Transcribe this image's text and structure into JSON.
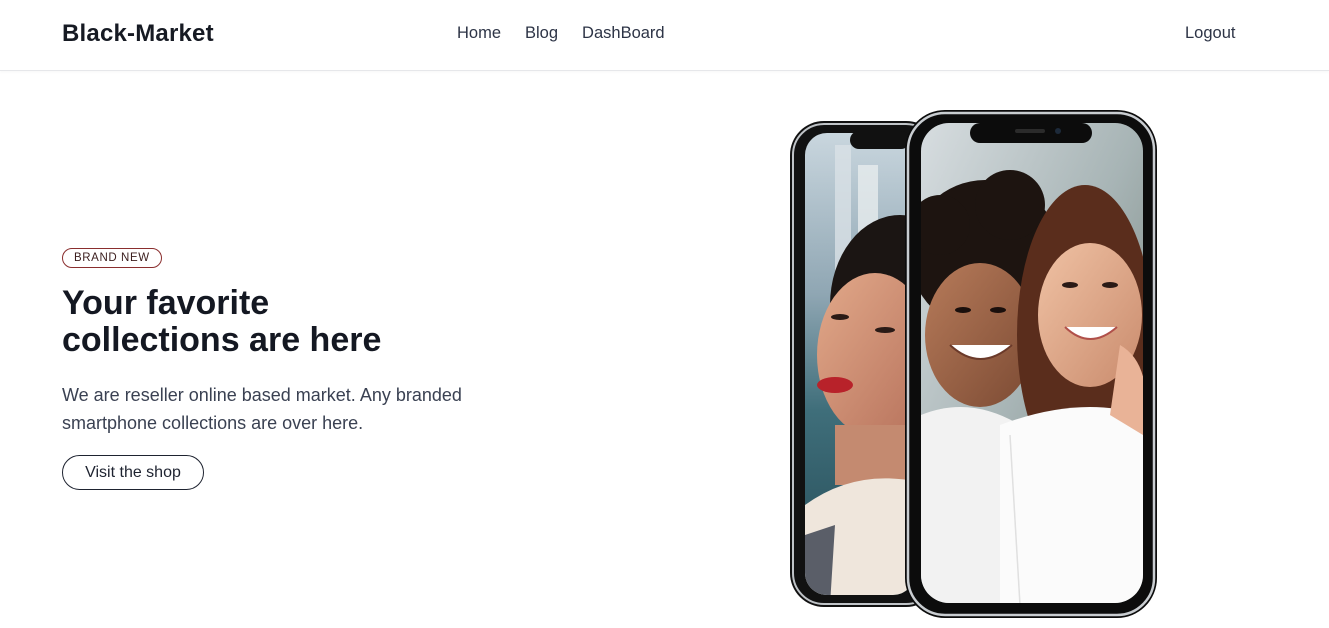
{
  "navbar": {
    "brand": "Black-Market",
    "links": [
      {
        "label": "Home"
      },
      {
        "label": "Blog"
      },
      {
        "label": "DashBoard"
      }
    ],
    "logout": "Logout"
  },
  "hero": {
    "badge": "BRAND NEW",
    "headline_lines": [
      "Your favorite",
      "collections are here"
    ],
    "description_lines": [
      "We are reseller online based market. Any branded",
      "smartphone collections are over here."
    ],
    "cta": "Visit the shop"
  },
  "colors": {
    "text_dark": "#141822",
    "text_body": "#3a4152",
    "badge_border": "#8a2e2e",
    "background": "#ffffff"
  },
  "icons": {
    "hero_image": "two-smartphones-with-selfie-photos"
  }
}
